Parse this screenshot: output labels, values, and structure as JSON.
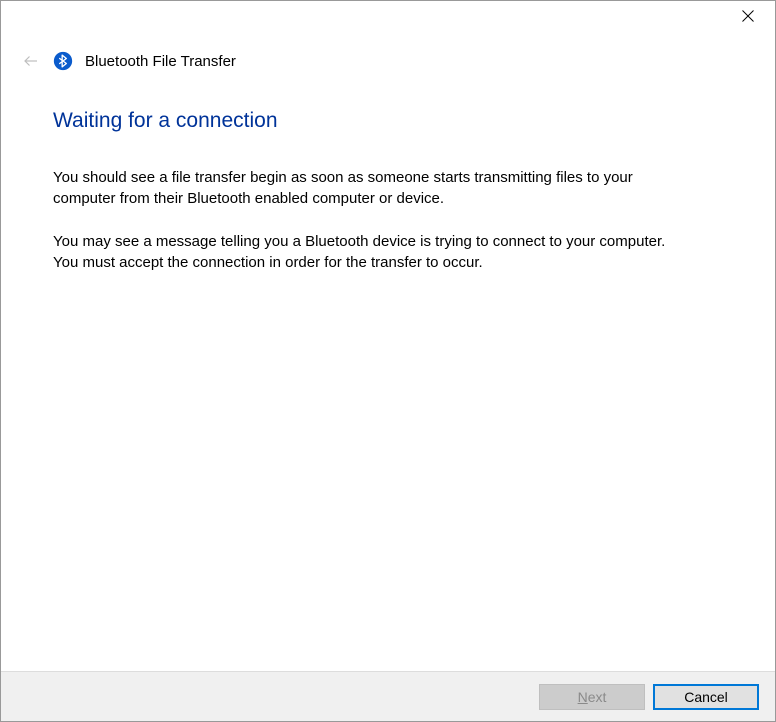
{
  "titlebar": {
    "close_label": "Close"
  },
  "header": {
    "wizard_title": "Bluetooth File Transfer"
  },
  "main": {
    "heading": "Waiting for a connection",
    "paragraph1": "You should see a file transfer begin as soon as someone starts transmitting files to your computer from their Bluetooth enabled computer or device.",
    "paragraph2": "You may see a message telling you a Bluetooth device is trying to connect to your computer. You must accept the connection in order for the transfer to occur."
  },
  "footer": {
    "next_label": "Next",
    "cancel_label": "Cancel",
    "next_enabled": false
  },
  "colors": {
    "accent": "#0078d7",
    "heading": "#003399"
  }
}
